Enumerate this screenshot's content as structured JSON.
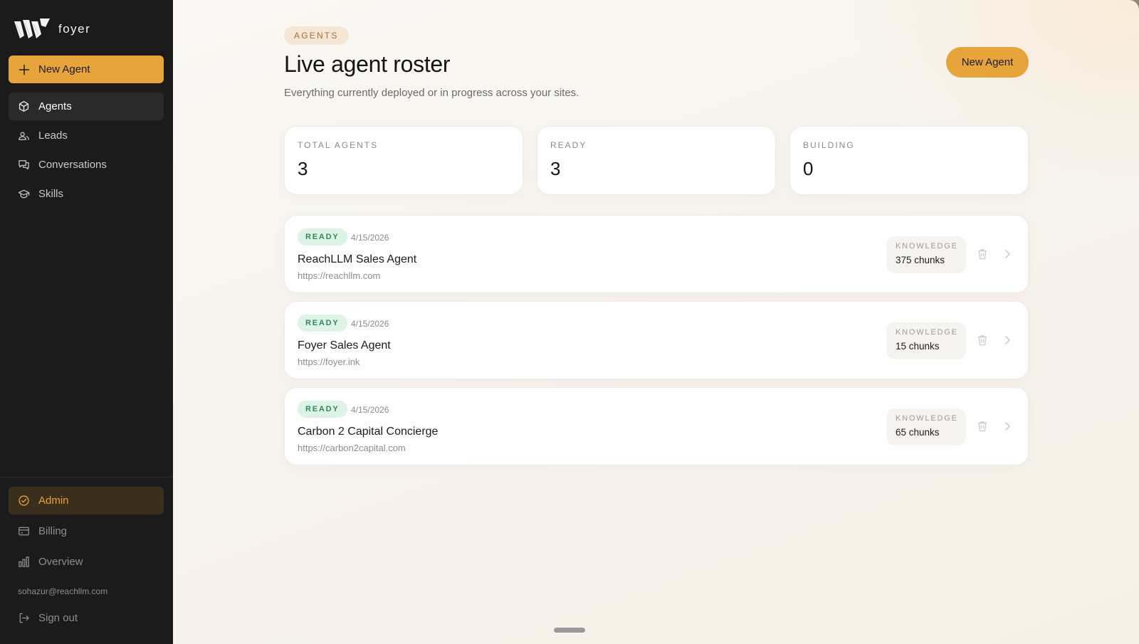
{
  "brand": {
    "name": "foyer"
  },
  "sidebar": {
    "new_agent_label": "New Agent",
    "items": [
      {
        "label": "Agents",
        "icon": "cube-icon",
        "active": true
      },
      {
        "label": "Leads",
        "icon": "leads-icon",
        "active": false
      },
      {
        "label": "Conversations",
        "icon": "chat-icon",
        "active": false
      },
      {
        "label": "Skills",
        "icon": "graduation-cap-icon",
        "active": false
      }
    ],
    "bottom_items": [
      {
        "label": "Admin",
        "icon": "check-circle-icon",
        "active": true
      },
      {
        "label": "Billing",
        "icon": "credit-card-icon",
        "active": false
      },
      {
        "label": "Overview",
        "icon": "bar-chart-icon",
        "active": false
      }
    ],
    "user_email": "sohazur@reachllm.com",
    "sign_out_label": "Sign out"
  },
  "header": {
    "eyebrow": "AGENTS",
    "title": "Live agent roster",
    "subtitle": "Everything currently deployed or in progress across your sites.",
    "new_agent_label": "New Agent"
  },
  "stats": [
    {
      "label": "TOTAL AGENTS",
      "value": "3"
    },
    {
      "label": "READY",
      "value": "3"
    },
    {
      "label": "BUILDING",
      "value": "0"
    }
  ],
  "agents": [
    {
      "status": "READY",
      "date": "4/15/2026",
      "name": "ReachLLM Sales Agent",
      "url": "https://reachllm.com",
      "knowledge_label": "KNOWLEDGE",
      "knowledge_value": "375 chunks"
    },
    {
      "status": "READY",
      "date": "4/15/2026",
      "name": "Foyer Sales Agent",
      "url": "https://foyer.ink",
      "knowledge_label": "KNOWLEDGE",
      "knowledge_value": "15 chunks"
    },
    {
      "status": "READY",
      "date": "4/15/2026",
      "name": "Carbon 2 Capital Concierge",
      "url": "https://carbon2capital.com",
      "knowledge_label": "KNOWLEDGE",
      "knowledge_value": "65 chunks"
    }
  ],
  "colors": {
    "accent": "#e6a43a",
    "sidebar_bg": "#1b1b1b",
    "ready_badge_bg": "#dcf3e6",
    "ready_badge_text": "#2f8a58"
  }
}
